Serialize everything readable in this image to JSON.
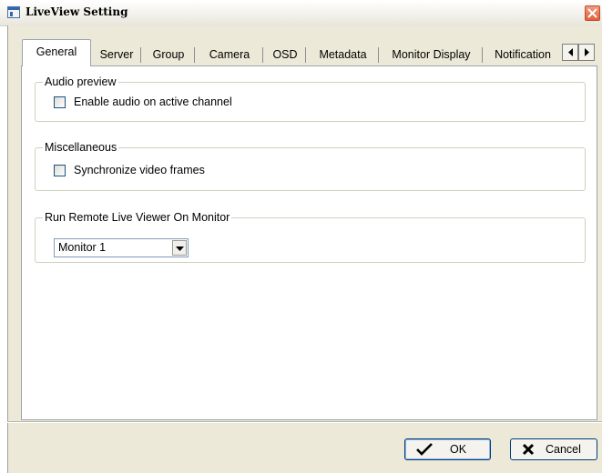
{
  "window": {
    "title": "LiveView Setting"
  },
  "tabs": [
    {
      "label": "General",
      "active": true
    },
    {
      "label": "Server"
    },
    {
      "label": "Group"
    },
    {
      "label": "Camera"
    },
    {
      "label": "OSD"
    },
    {
      "label": "Metadata"
    },
    {
      "label": "Monitor Display"
    },
    {
      "label": "Notification"
    }
  ],
  "audio_preview": {
    "legend": "Audio preview",
    "checkbox_label": "Enable audio on active channel",
    "checked": false
  },
  "miscellaneous": {
    "legend": "Miscellaneous",
    "checkbox_label": "Synchronize video frames",
    "checked": false
  },
  "remote_viewer": {
    "legend": "Run Remote Live Viewer On Monitor",
    "selected": "Monitor 1"
  },
  "buttons": {
    "ok": "OK",
    "cancel": "Cancel"
  }
}
